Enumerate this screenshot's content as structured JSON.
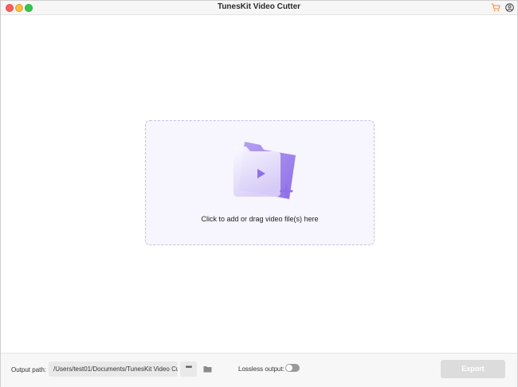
{
  "window": {
    "title": "TunesKit Video Cutter"
  },
  "titlebar_icons": {
    "cart": "cart-icon",
    "account": "account-icon",
    "cart_color": "#f28c38"
  },
  "dropzone": {
    "icon": "add-video-folder-icon",
    "text": "Click to add or drag video file(s) here",
    "accent_color": "#8f70e8"
  },
  "footer": {
    "output_path_label": "Output path:",
    "output_path_value": "/Users/test01/Documents/TunesKit Video Cut",
    "more_button_label": "•••",
    "folder_icon": "folder-icon",
    "lossless_label": "Lossless output:",
    "lossless_enabled": false,
    "export_label": "Export",
    "export_enabled": false
  }
}
